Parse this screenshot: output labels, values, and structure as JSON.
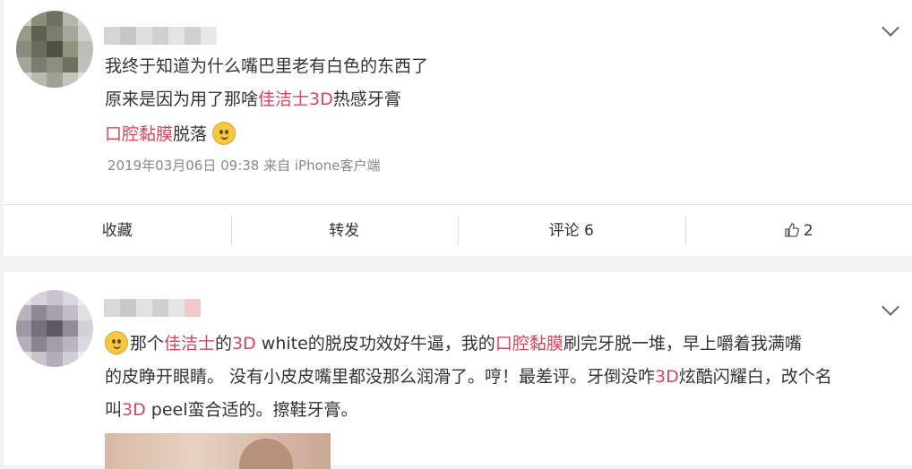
{
  "post1": {
    "lines": [
      {
        "pre": "我终于知道为什么嘴巴里老有白色的东西了"
      },
      {
        "pre": "原来是因为用了那啥",
        "hl": "佳洁士3D",
        "post": "热感牙膏"
      },
      {
        "hl": "口腔黏膜",
        "post": "脱落"
      }
    ],
    "emoji_icon": "thinking-face-emoji",
    "meta": "2019年03月06日 09:38   来自 iPhone客户端",
    "actions": {
      "favorite": "收藏",
      "repost": "转发",
      "comment": "评论 6",
      "like_count": "2"
    }
  },
  "post2": {
    "line1": {
      "a": "那个",
      "b": "佳洁士",
      "c": "的",
      "d": "3D",
      "e": " white的脱皮功效好牛逼，我的",
      "f": "口腔黏膜",
      "g": "刷完牙脱一堆，早上嚼着我满嘴"
    },
    "line2": {
      "a": "的皮睁开眼睛。 没有小皮皮嘴里都没那么润滑了。哼！最差评。牙倒没咋",
      "b": "3D",
      "c": "炫酷闪耀白，改个名"
    },
    "line3": {
      "a": "叫",
      "b": "3D",
      "c": " peel蛮合适的。擦鞋牙膏。"
    },
    "emoji_icon": "grimacing-face-emoji"
  },
  "colors": {
    "highlight": "#d0485c",
    "text": "#333333",
    "meta": "#888888",
    "background": "#f2f2f2"
  }
}
